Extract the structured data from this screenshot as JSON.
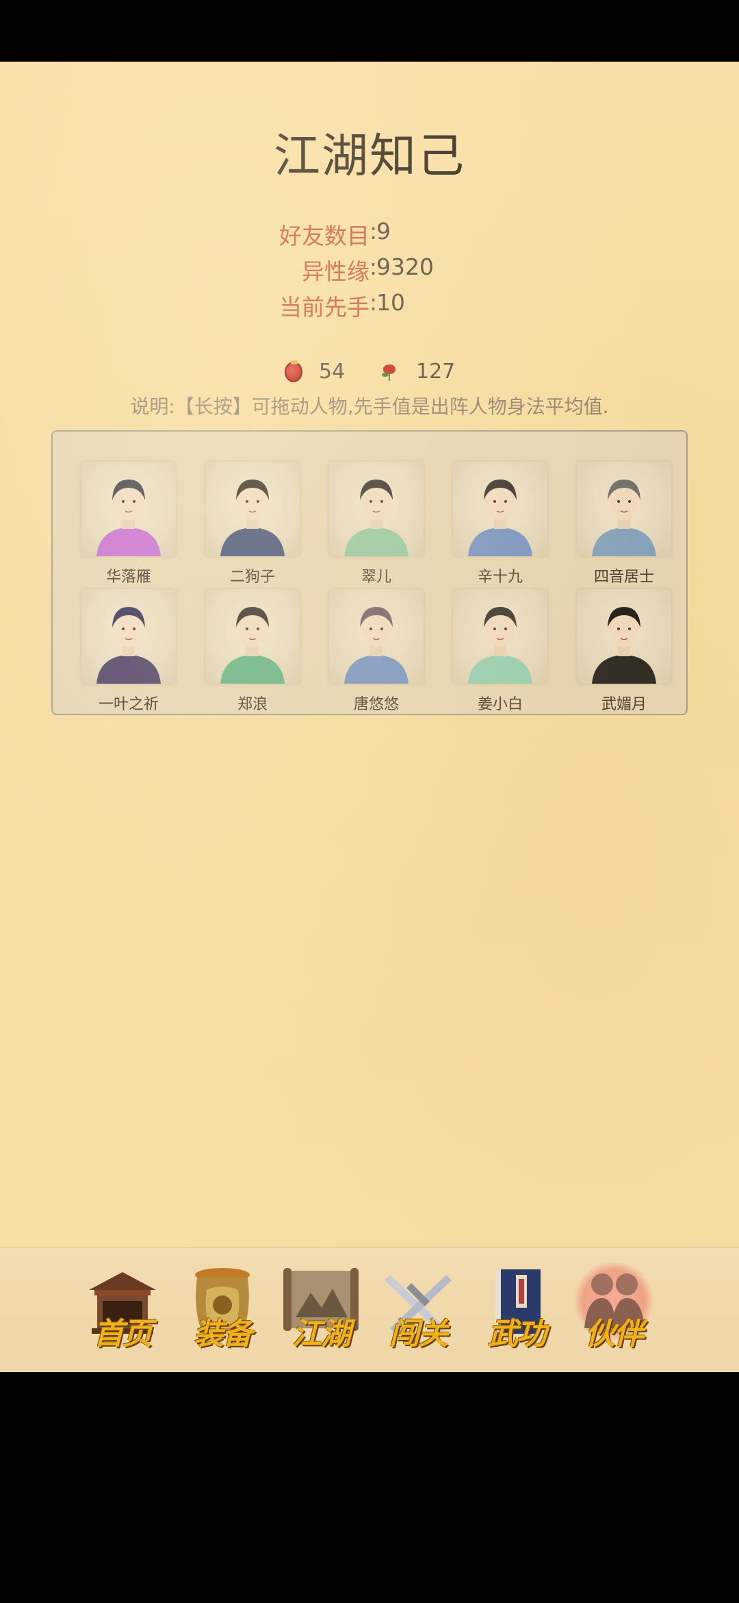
{
  "page": {
    "title": "江湖知己"
  },
  "stats": [
    {
      "label": "好友数目",
      "value": "9"
    },
    {
      "label": "异性缘",
      "value": "9320"
    },
    {
      "label": "当前先手",
      "value": "10"
    }
  ],
  "currency": {
    "coin": {
      "icon": "red-gem-icon",
      "value": "54"
    },
    "rose": {
      "icon": "rose-icon",
      "value": "127"
    }
  },
  "note": "说明:【长按】可拖动人物,先手值是出阵人物身法平均值.",
  "characters": [
    {
      "name": "华落雁",
      "robe": "#c86ad6",
      "hair": "#3a3a4a"
    },
    {
      "name": "二狗子",
      "robe": "#3d4d7a",
      "hair": "#2a2520"
    },
    {
      "name": "翠儿",
      "robe": "#8fc7a6",
      "hair": "#2a2a2a"
    },
    {
      "name": "辛十九",
      "robe": "#6f8fc8",
      "hair": "#2a2a2a"
    },
    {
      "name": "四音居士",
      "robe": "#7e9fc0",
      "hair": "#6a6a6a"
    },
    {
      "name": "一叶之祈",
      "robe": "#4a3f6a",
      "hair": "#2e2e5a"
    },
    {
      "name": "郑浪",
      "robe": "#5fb38a",
      "hair": "#2a2a2a"
    },
    {
      "name": "唐悠悠",
      "robe": "#7090c8",
      "hair": "#6a5a6a"
    },
    {
      "name": "姜小白",
      "robe": "#8ed0b6",
      "hair": "#2a2a2a"
    },
    {
      "name": "武媚月",
      "robe": "#1a1a1a",
      "hair": "#111111"
    }
  ],
  "nav": [
    {
      "label": "首页",
      "icon": "temple-icon"
    },
    {
      "label": "装备",
      "icon": "armor-icon"
    },
    {
      "label": "江湖",
      "icon": "map-scroll-icon"
    },
    {
      "label": "闯关",
      "icon": "crossed-swords-icon"
    },
    {
      "label": "武功",
      "icon": "book-icon"
    },
    {
      "label": "伙伴",
      "icon": "partners-icon",
      "active": true
    }
  ]
}
